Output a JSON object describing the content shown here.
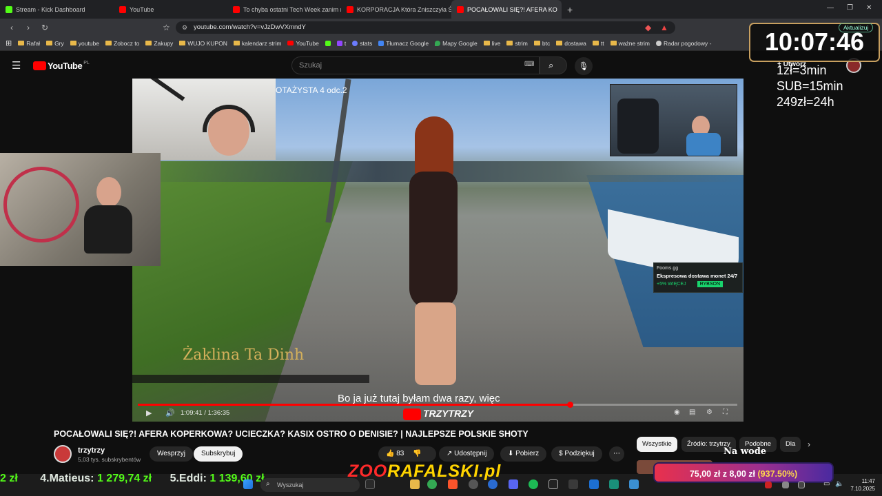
{
  "browser": {
    "tabs": [
      {
        "label": "Stream - Kick Dashboard",
        "icon": "kick-icon",
        "active": false
      },
      {
        "label": "YouTube",
        "icon": "youtube-icon",
        "active": false
      },
      {
        "label": "To chyba ostatni Tech Week zanim ni",
        "icon": "youtube-icon",
        "active": false
      },
      {
        "label": "KORPORACJA Która Zniszczyła Świat",
        "icon": "youtube-icon",
        "active": false
      },
      {
        "label": "POCAŁOWALI SIĘ?! AFERA KO",
        "icon": "youtube-icon",
        "active": true
      }
    ],
    "new_tab": "+",
    "url": "youtube.com/watch?v=vJzDwVXmndY",
    "update_label": "Aktualizuj",
    "bookmarks": [
      "Rafał",
      "Gry",
      "youtube",
      "Zobocz to",
      "Zakupy",
      "WUJO KUPON",
      "kalendarz strim",
      "YouTube",
      "t",
      "stats",
      "Tłumacz Google",
      "Mapy Google",
      "live",
      "strim",
      "btc",
      "dostawa",
      "tt",
      "ważne strim",
      "Radar pogodowy -"
    ]
  },
  "youtube": {
    "logo_text": "YouTube",
    "logo_region": "PL",
    "search_placeholder": "Szukaj",
    "create_label": "Utwórz"
  },
  "stream_overlay": {
    "timer": "10:07:46",
    "rates": [
      "1zł=3min",
      "SUB=15min",
      "249zł=24h"
    ],
    "ticker": [
      {
        "name": "4.Matieus:",
        "amount": "1 279,74 zł"
      },
      {
        "name": "5.Eddi:",
        "amount": "1 139,60 zł"
      }
    ],
    "ticker_prefix": "2 zł",
    "logo_red": "ZOO",
    "logo_yellow": "RAFALSKI.pl",
    "donation": {
      "text": "75,00 zł z 8,00 zł",
      "percent": "(937.50%)"
    }
  },
  "video": {
    "top_text": "OTAŻYSTA 4 odc.2",
    "name_caption": "Żaklina Ta Dinh",
    "subtitle": "Bo ja już tutaj byłam dwa razy, więc",
    "watermark": "TRZYTRZY",
    "time_current": "1:09:41",
    "time_total": "1:36:35",
    "progress": 0.721,
    "ad": {
      "brand": "Fooms.gg",
      "headline": "Ekspresowa dostawa monet 24/7",
      "promo": "+5% WIĘCEJ",
      "code": "RYBSON"
    }
  },
  "watch": {
    "title": "POCAŁOWALI SIĘ?! AFERA KOPERKOWA? UCIECZKA? KASIX OSTRO O DENISIE? | NAJLEPSZE POLSKIE SHOTY",
    "channel": "trzytrzy",
    "subscribers": "5,03 tys. subskrybentów",
    "support": "Wesprzyj",
    "subscribe": "Subskrybuj",
    "likes": "83",
    "share": "Udostępnij",
    "download": "Pobierz",
    "thanks": "Podziękuj",
    "more": "⋯",
    "chips": [
      "Wszystkie",
      "Źródło: trzytrzy",
      "Podobne",
      "Dla"
    ],
    "rec_title": "Na wode"
  },
  "taskbar": {
    "search": "Wyszukaj",
    "time": "11:47",
    "date": "7.10.2025"
  }
}
